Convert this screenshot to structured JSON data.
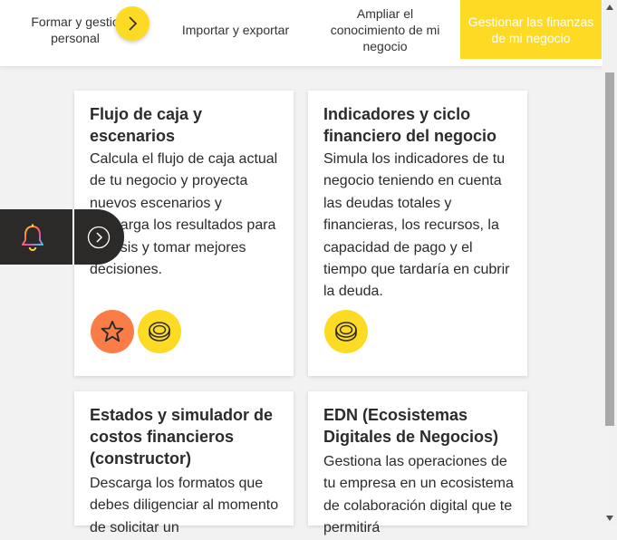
{
  "tabs": [
    {
      "label": "Formar y gestionar lo personal"
    },
    {
      "label": "Importar y exportar"
    },
    {
      "label": "Ampliar el conocimiento de mi negocio"
    },
    {
      "label": "Gestionar las finanzas de mi negocio"
    }
  ],
  "tab_first_visible": "Formar y gestio personal",
  "cards": [
    {
      "title": "Flujo de caja y escenarios",
      "description": "Calcula el flujo de caja actual de tu negocio y proyecta nuevos escenarios y descarga los resultados para análisis y tomar mejores decisiones.",
      "desc_visible": "Calcula el flujo de caja actual de tu negocio y proyecta nuevos escenarios y\nrga los resultados para\nanálisis y tomar\nmejores decisiones.",
      "icons": [
        "star-icon",
        "coin-icon"
      ]
    },
    {
      "title": "Indicadores y ciclo financiero del negocio",
      "description": "Simula los indicadores de tu negocio teniendo en cuenta las deudas totales y financieras, los recursos, la capacidad de pago y el tiempo que tardaría en cubrir la deuda.",
      "icons": [
        "coin-icon"
      ]
    },
    {
      "title": "Estados y simulador de costos financieros (constructor)",
      "description": "Descarga los formatos que debes diligenciar al momento de solicitar un"
    },
    {
      "title": "EDN (Ecosistemas Digitales de Negocios)",
      "description": "Gestiona las operaciones de tu empresa en un ecosistema de colaboración digital que te permitirá"
    }
  ],
  "colors": {
    "accent": "#fdda24",
    "orange": "#fa7c46",
    "dark": "#2c2a29"
  }
}
